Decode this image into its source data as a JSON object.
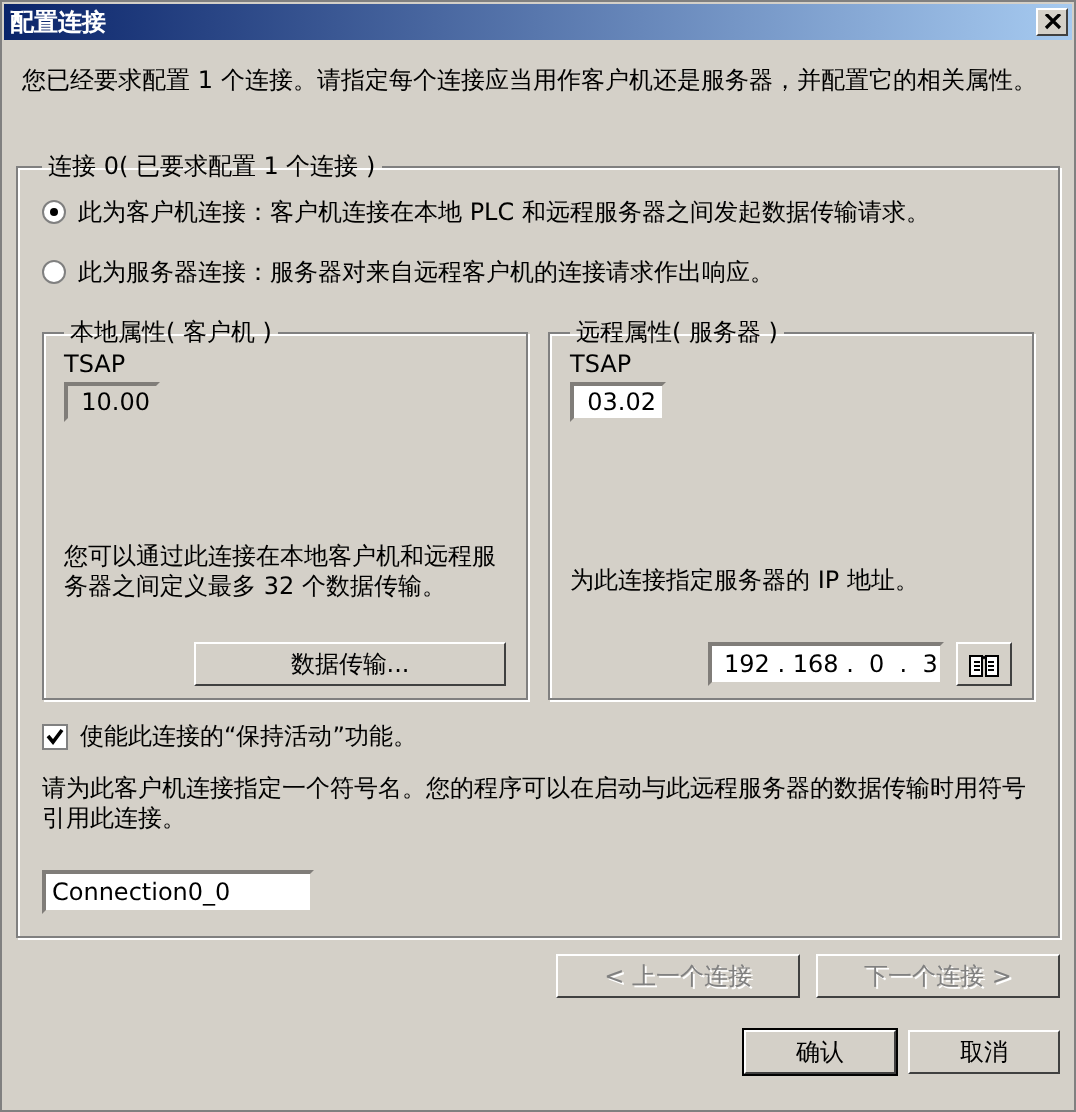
{
  "window": {
    "title": "配置连接"
  },
  "intro": "您已经要求配置 1 个连接。请指定每个连接应当用作客户机还是服务器，并配置它的相关属性。",
  "connection_group": {
    "title": "连接 0( 已要求配置 1 个连接 )"
  },
  "roles": [
    {
      "label": "此为客户机连接：客户机连接在本地 PLC 和远程服务器之间发起数据传输请求。",
      "selected": true
    },
    {
      "label": "此为服务器连接：服务器对来自远程客户机的连接请求作出响应。",
      "selected": false
    }
  ],
  "local": {
    "title": "本地属性( 客户机 )",
    "tsap_label": "TSAP",
    "tsap_value": "10.00",
    "tsap_disabled": true,
    "description": "您可以通过此连接在本地客户机和远程服务器之间定义最多 32 个数据传输。",
    "button": "数据传输..."
  },
  "remote": {
    "title": "远程属性( 服务器 )",
    "tsap_label": "TSAP",
    "tsap_value": "03.02",
    "tsap_disabled": false,
    "description": "为此连接指定服务器的 IP 地址。",
    "ip_address": "192 . 168 .  0  .  3"
  },
  "keep_alive": {
    "label": "使能此连接的“保持活动”功能。",
    "checked": true
  },
  "symbol_description": "请为此客户机连接指定一个符号名。您的程序可以在启动与此远程服务器的数据传输时用符号引用此连接。",
  "symbol_name": "Connection0_0",
  "nav_buttons": [
    {
      "label": "< 上一个连接",
      "disabled": true
    },
    {
      "label": "下一个连接 >",
      "disabled": true
    }
  ],
  "dialog_buttons": [
    {
      "label": "确认",
      "default": true
    },
    {
      "label": "取消",
      "default": false
    }
  ]
}
